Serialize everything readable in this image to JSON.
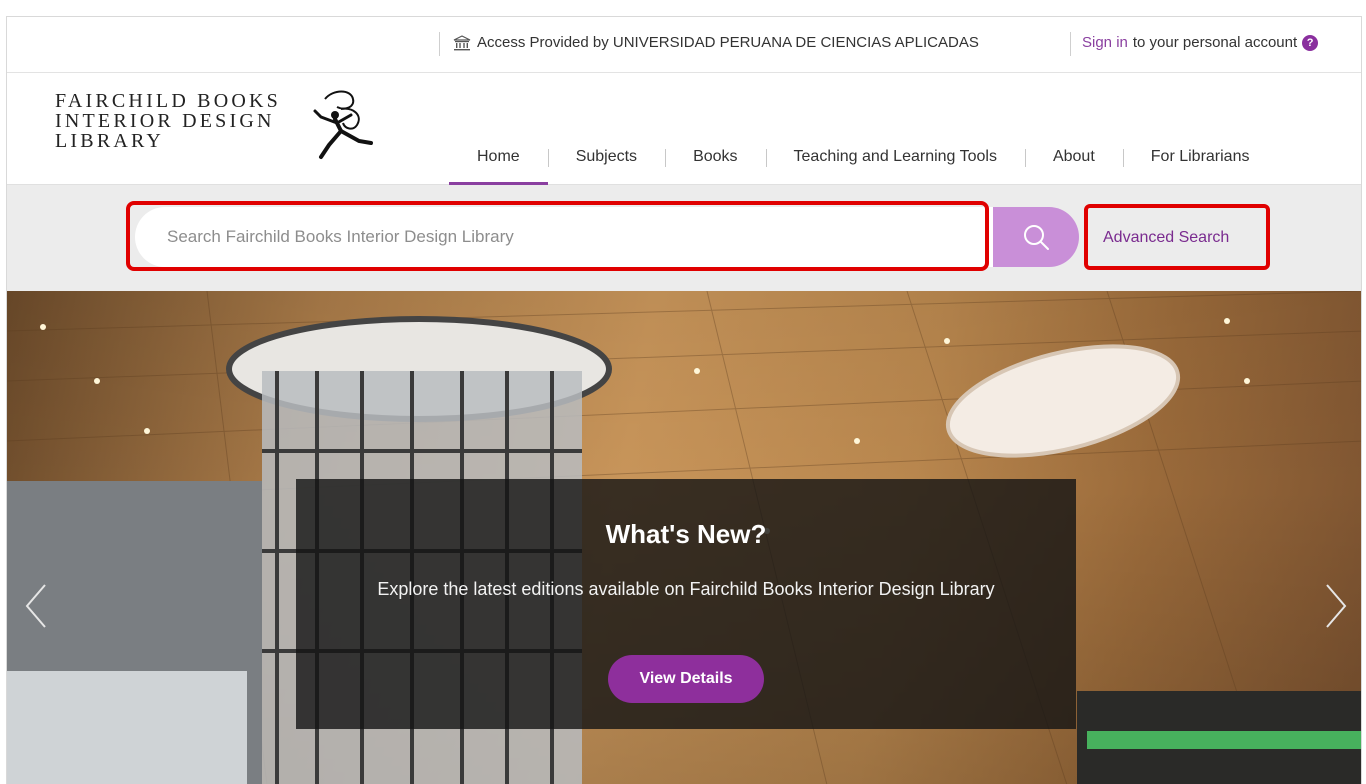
{
  "topbar": {
    "access_text": "Access Provided by UNIVERSIDAD PERUANA DE CIENCIAS APLICADAS",
    "signin_link": "Sign in",
    "signin_suffix": "to your personal account",
    "help_glyph": "?"
  },
  "logo": {
    "line1": "FAIRCHILD BOOKS",
    "line2": "INTERIOR DESIGN",
    "line3": "LIBRARY"
  },
  "nav": {
    "items": [
      {
        "label": "Home",
        "active": true
      },
      {
        "label": "Subjects"
      },
      {
        "label": "Books"
      },
      {
        "label": "Teaching and Learning Tools"
      },
      {
        "label": "About"
      },
      {
        "label": "For Librarians"
      }
    ]
  },
  "search": {
    "placeholder": "Search Fairchild Books Interior Design Library",
    "advanced_label": "Advanced Search",
    "icon": "search-icon"
  },
  "hero": {
    "title": "What's New?",
    "subtitle": "Explore the latest editions available on Fairchild Books Interior Design Library",
    "button_label": "View Details"
  },
  "colors": {
    "accent": "#8a3fa0",
    "search_button": "#c98fd8",
    "highlight": "#e00000",
    "hero_button": "#8e2f9c"
  }
}
